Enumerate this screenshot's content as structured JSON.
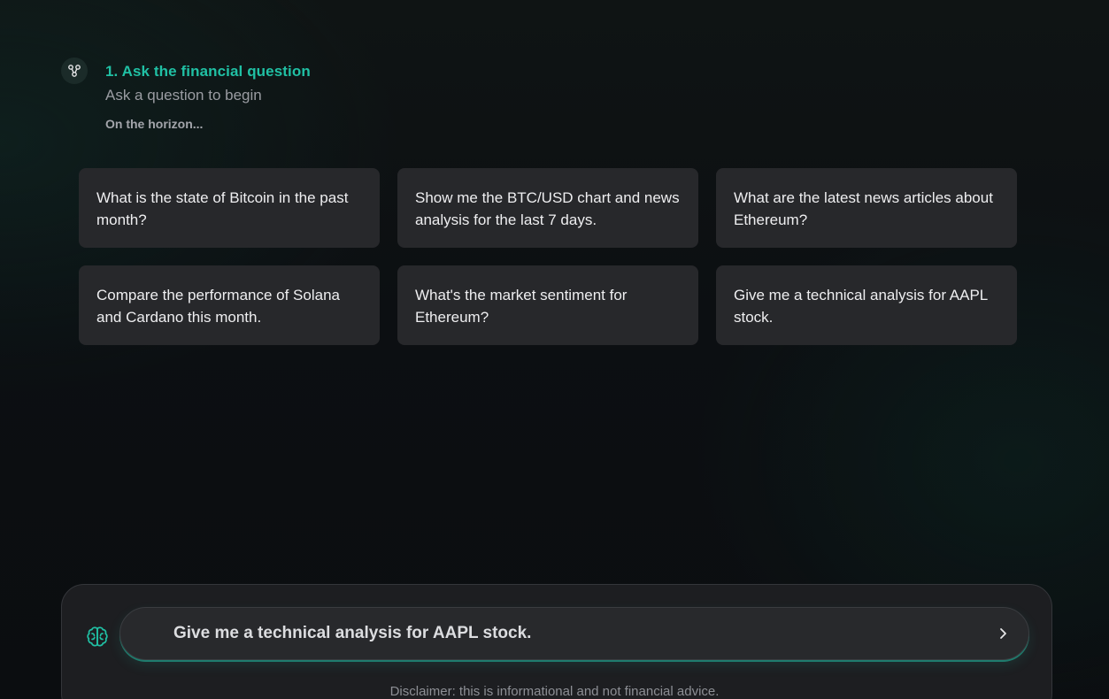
{
  "step": {
    "icon": "branch-icon",
    "title": "1. Ask the financial question",
    "subtitle": "Ask a question to begin",
    "horizon": "On the horizon..."
  },
  "suggestions": [
    "What is the state of Bitcoin in the past month?",
    "Show me the BTC/USD chart and news analysis for the last 7 days.",
    "What are the latest news articles about Ethereum?",
    "Compare the performance of Solana and Cardano this month.",
    "What's the market sentiment for Ethereum?",
    "Give me a technical analysis for AAPL stock."
  ],
  "input": {
    "icon": "brain-icon",
    "value": "Give me a technical analysis for AAPL stock.",
    "send_icon": "chevron-right-icon"
  },
  "disclaimer": "Disclaimer: this is informational and not financial advice.",
  "colors": {
    "accent": "#20c0a4",
    "card_bg": "#27282b",
    "page_bg": "#0c0f12"
  }
}
